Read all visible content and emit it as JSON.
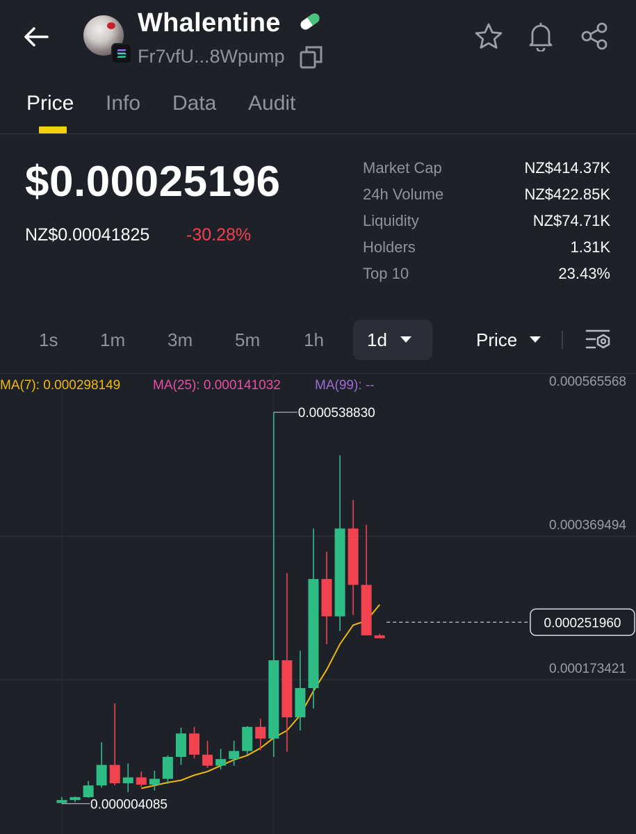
{
  "header": {
    "token_name": "Whalentine",
    "address": "Fr7vfU...8Wpump",
    "icons": [
      "back-arrow-icon",
      "solana-chain-icon",
      "pill-icon",
      "copy-icon",
      "star-icon",
      "bell-icon",
      "share-icon"
    ]
  },
  "tabs": [
    {
      "label": "Price",
      "active": true
    },
    {
      "label": "Info",
      "active": false
    },
    {
      "label": "Data",
      "active": false
    },
    {
      "label": "Audit",
      "active": false
    }
  ],
  "price": {
    "usd": "$0.00025196",
    "nzd": "NZ$0.00041825",
    "change": "-30.28%"
  },
  "stats": [
    {
      "label": "Market Cap",
      "value": "NZ$414.37K"
    },
    {
      "label": "24h Volume",
      "value": "NZ$422.85K"
    },
    {
      "label": "Liquidity",
      "value": "NZ$74.71K"
    },
    {
      "label": "Holders",
      "value": "1.31K"
    },
    {
      "label": "Top 10",
      "value": "23.43%"
    }
  ],
  "intervals": [
    {
      "label": "1s",
      "active": false
    },
    {
      "label": "1m",
      "active": false
    },
    {
      "label": "3m",
      "active": false
    },
    {
      "label": "5m",
      "active": false
    },
    {
      "label": "1h",
      "active": false
    },
    {
      "label": "1d",
      "active": true
    }
  ],
  "chart_mode_label": "Price",
  "ma_legend": [
    {
      "label": "MA(7): 0.000298149",
      "color": "#f0b90b"
    },
    {
      "label": "MA(25): 0.000141032",
      "color": "#e84fa5"
    },
    {
      "label": "MA(99): --",
      "color": "#9b6cd6"
    }
  ],
  "colors": {
    "up": "#2ebd85",
    "down": "#f0424f",
    "accent": "#f5d00f",
    "ma7": "#f0b90b"
  },
  "chart_data": {
    "type": "candlestick",
    "y_tick_labels": [
      "0.000565568",
      "0.000369494",
      "0.000173421"
    ],
    "y_ticks": [
      0.000565568,
      0.000369494,
      0.000173421
    ],
    "max_label": "0.000538830",
    "max_value": 0.00053883,
    "min_label": "0.000004085",
    "min_value": 4.085e-06,
    "last_price_label": "0.000251960",
    "last_price": 0.00025196,
    "candles": [
      {
        "o": 5e-06,
        "h": 1.3e-05,
        "l": 4.1e-06,
        "c": 9e-06
      },
      {
        "o": 9e-06,
        "h": 1.4e-05,
        "l": 6e-06,
        "c": 1.3e-05
      },
      {
        "o": 1.3e-05,
        "h": 3.5e-05,
        "l": 1.2e-05,
        "c": 2.9e-05
      },
      {
        "o": 2.9e-05,
        "h": 8.8e-05,
        "l": 2.6e-05,
        "c": 5.7e-05
      },
      {
        "o": 5.7e-05,
        "h": 0.000141,
        "l": 2.9e-05,
        "c": 3.2e-05
      },
      {
        "o": 3.2e-05,
        "h": 5.9e-05,
        "l": 2e-05,
        "c": 4e-05
      },
      {
        "o": 4e-05,
        "h": 4.8e-05,
        "l": 2.7e-05,
        "c": 3e-05
      },
      {
        "o": 3e-05,
        "h": 4.9e-05,
        "l": 2.2e-05,
        "c": 3.8e-05
      },
      {
        "o": 3.8e-05,
        "h": 7e-05,
        "l": 3.1e-05,
        "c": 6.8e-05
      },
      {
        "o": 6.8e-05,
        "h": 0.000108,
        "l": 5.7e-05,
        "c": 0.0001
      },
      {
        "o": 0.0001,
        "h": 0.000109,
        "l": 6.6e-05,
        "c": 7.1e-05
      },
      {
        "o": 7.1e-05,
        "h": 9e-05,
        "l": 5.3e-05,
        "c": 5.6e-05
      },
      {
        "o": 5.6e-05,
        "h": 7.9e-05,
        "l": 5.1e-05,
        "c": 6.5e-05
      },
      {
        "o": 6.5e-05,
        "h": 9e-05,
        "l": 5.6e-05,
        "c": 7.6e-05
      },
      {
        "o": 7.6e-05,
        "h": 0.00011,
        "l": 7.1e-05,
        "c": 0.000109
      },
      {
        "o": 0.000109,
        "h": 0.00012,
        "l": 7.7e-05,
        "c": 9.3e-05
      },
      {
        "o": 9.3e-05,
        "h": 0.0005388,
        "l": 6.8e-05,
        "c": 0.0002
      },
      {
        "o": 0.0002,
        "h": 0.000319,
        "l": 7.5e-05,
        "c": 0.000122
      },
      {
        "o": 0.000122,
        "h": 0.000213,
        "l": 0.000104,
        "c": 0.000162
      },
      {
        "o": 0.000162,
        "h": 0.00038,
        "l": 0.000134,
        "c": 0.000311
      },
      {
        "o": 0.000311,
        "h": 0.000348,
        "l": 0.000222,
        "c": 0.00026
      },
      {
        "o": 0.00026,
        "h": 0.00048,
        "l": 0.00024,
        "c": 0.00038
      },
      {
        "o": 0.00038,
        "h": 0.000419,
        "l": 0.000262,
        "c": 0.000303
      },
      {
        "o": 0.000303,
        "h": 0.000385,
        "l": 0.000234,
        "c": 0.000234
      },
      {
        "o": 0.000234,
        "h": 0.000236,
        "l": 0.00023,
        "c": 0.00023
      }
    ],
    "ma7": [
      null,
      null,
      null,
      null,
      null,
      null,
      2.5e-05,
      2.9e-05,
      3.3e-05,
      3.6e-05,
      4.3e-05,
      4.8e-05,
      5.6e-05,
      6.4e-05,
      7e-05,
      8e-05,
      9.4e-05,
      0.000104,
      0.000125,
      0.000158,
      0.000187,
      0.000222,
      0.000248,
      0.000254,
      0.000276
    ]
  }
}
